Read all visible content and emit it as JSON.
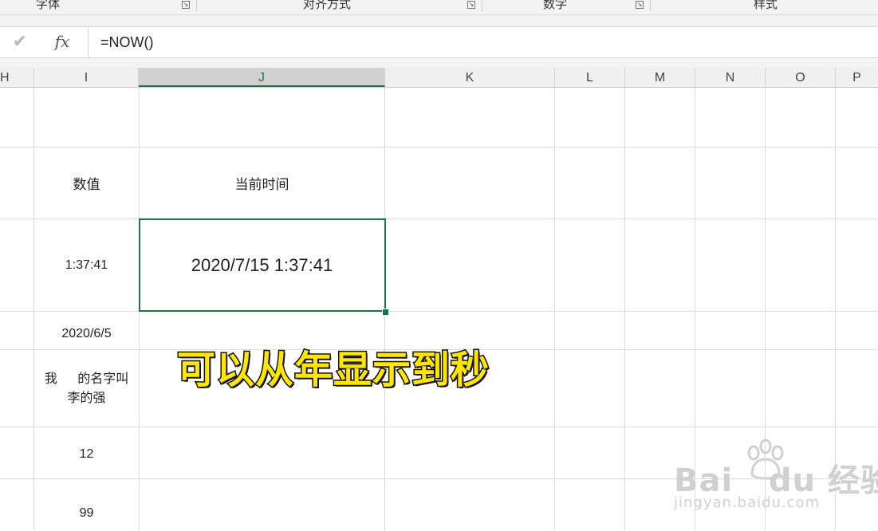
{
  "ribbon": {
    "groups": [
      "字体",
      "对齐方式",
      "数字",
      "样式"
    ]
  },
  "formula_bar": {
    "check_glyph": "✔",
    "fx_label": "fx",
    "formula": "=NOW()"
  },
  "columns": [
    "H",
    "I",
    "J",
    "K",
    "L",
    "M",
    "N",
    "O",
    "P"
  ],
  "cells": {
    "i_header": "数值",
    "j_header": "当前时间",
    "i_time": "1:37:41",
    "j_now": "2020/7/15 1:37:41",
    "i_date": "2020/6/5",
    "i_text_line1": "我     的名字叫",
    "i_text_line2": "李的强",
    "i_num1": "12",
    "i_num2": "99"
  },
  "caption": "可以从年显示到秒",
  "watermark": {
    "logo": "Bai   du 经验",
    "url": "jingyan.baidu.com"
  },
  "colors": {
    "accent": "#217346",
    "caption_fill": "#ffe600",
    "caption_stroke": "#111111"
  }
}
